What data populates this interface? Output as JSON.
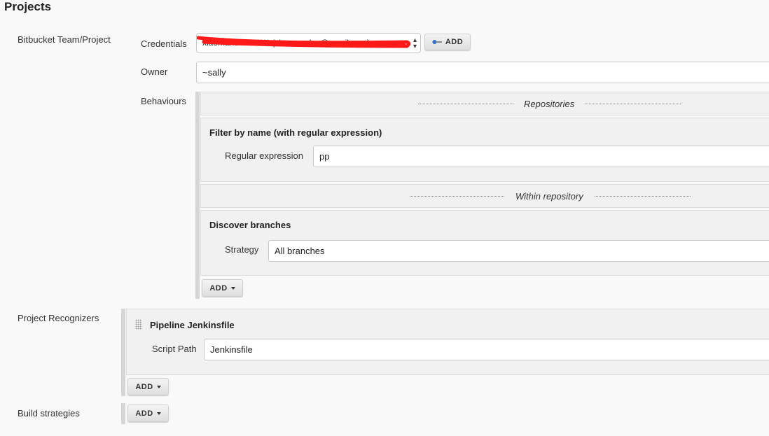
{
  "page": {
    "title": "Projects"
  },
  "rows": {
    "bitbucket_label": "Bitbucket Team/Project",
    "recognizers_label": "Project Recognizers",
    "build_strategies_label": "Build strategies"
  },
  "credentials": {
    "label": "Credentials",
    "value": "xiaomandev/****** (xiaomandev@gmail.com)",
    "add_button": "ADD"
  },
  "owner": {
    "label": "Owner",
    "value": "~sally"
  },
  "behaviours": {
    "label": "Behaviours",
    "repositories_title": "Repositories",
    "filter": {
      "title": "Filter by name (with regular expression)",
      "field_label": "Regular expression",
      "value": "pp"
    },
    "within_title": "Within repository",
    "discover": {
      "title": "Discover branches",
      "field_label": "Strategy",
      "value": "All branches"
    },
    "add_button": "ADD"
  },
  "recognizers": {
    "pipeline_title": "Pipeline Jenkinsfile",
    "script_label": "Script Path",
    "script_value": "Jenkinsfile",
    "add_button": "ADD"
  },
  "build_strategies": {
    "add_button": "ADD"
  },
  "colors": {
    "redaction": "#ff1a1a",
    "key_icon": "#2a6fd6"
  }
}
